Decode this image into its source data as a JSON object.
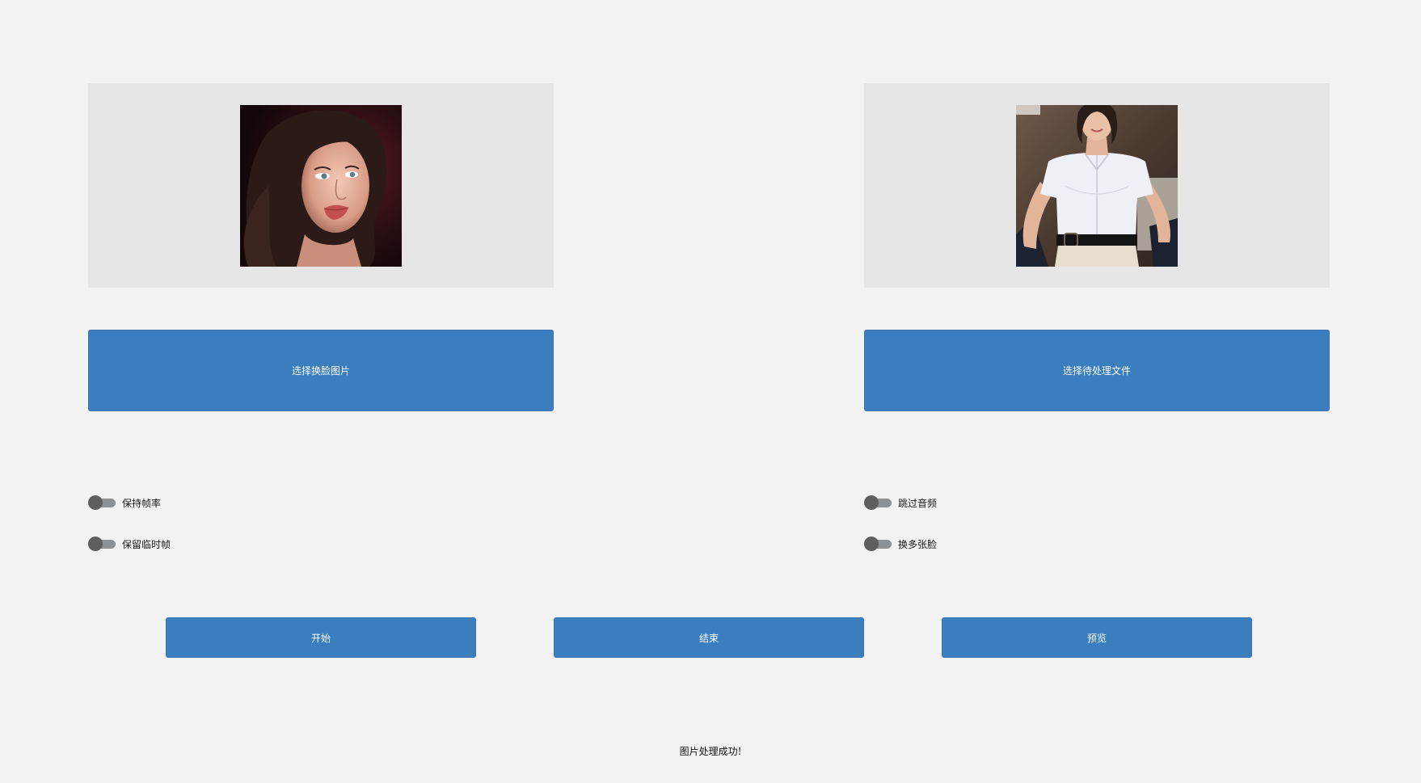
{
  "source_panel": {
    "image": "face-portrait-image"
  },
  "target_panel": {
    "image": "target-person-image"
  },
  "buttons": {
    "select_face": "选择换脸图片",
    "select_target": "选择待处理文件",
    "start": "开始",
    "stop": "结束",
    "preview": "预览"
  },
  "options": {
    "keep_fps": {
      "label": "保持帧率",
      "on": false
    },
    "keep_temp_frames": {
      "label": "保留临时帧",
      "on": false
    },
    "skip_audio": {
      "label": "跳过音频",
      "on": false
    },
    "many_faces": {
      "label": "换多张脸",
      "on": false
    }
  },
  "status_text": "图片处理成功!",
  "colors": {
    "background": "#f2f2f2",
    "panel": "#e6e6e6",
    "button": "#3a7ec0",
    "button_text": "#ffffff",
    "switch_track": "#8c9196",
    "switch_knob": "#5e5e5e"
  }
}
